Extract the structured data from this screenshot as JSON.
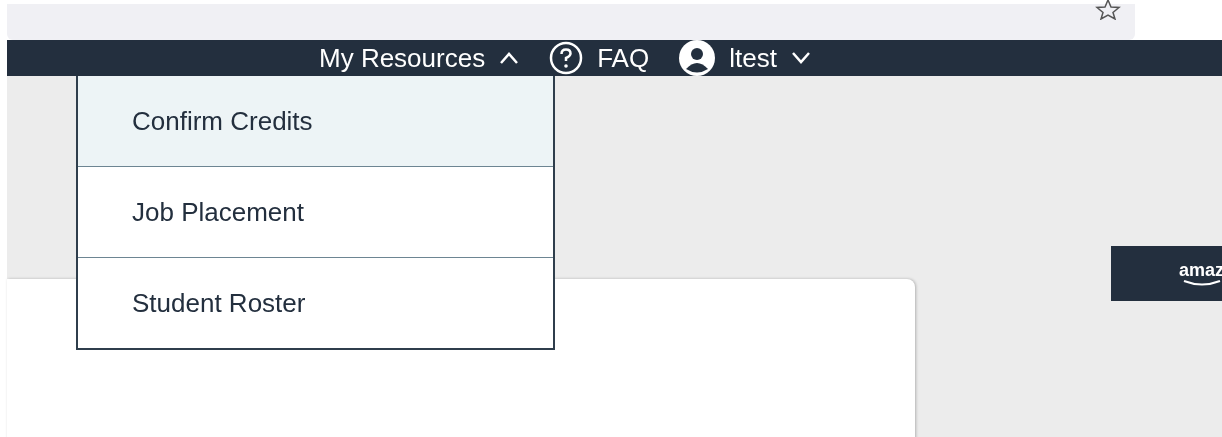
{
  "navbar": {
    "items": [
      {
        "kind": "menu",
        "label": "My Resources",
        "expanded": true
      },
      {
        "kind": "help",
        "label": "FAQ"
      },
      {
        "kind": "user",
        "label": "ltest",
        "expanded": false
      }
    ]
  },
  "dropdown": {
    "items": [
      {
        "label": "Confirm Credits",
        "selected": true
      },
      {
        "label": "Job Placement",
        "selected": false
      },
      {
        "label": "Student Roster",
        "selected": false
      }
    ]
  },
  "logo": {
    "text": "amaz"
  }
}
